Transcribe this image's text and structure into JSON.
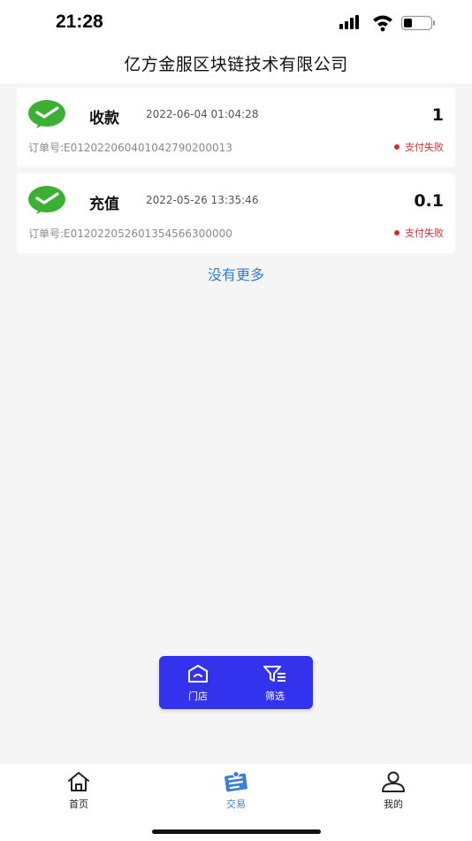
{
  "status_bar": {
    "time": "21:28"
  },
  "header": {
    "title": "亿方金服区块链技术有限公司"
  },
  "transactions": [
    {
      "type": "收款",
      "datetime": "2022-06-04 01:04:28",
      "amount": "1",
      "order_no": "订单号:E012022060401042790200013",
      "status": "支付失败"
    },
    {
      "type": "充值",
      "datetime": "2022-05-26 13:35:46",
      "amount": "0.1",
      "order_no": "订单号:E012022052601354566300000",
      "status": "支付失败"
    }
  ],
  "list_footer": "没有更多",
  "float_toolbar": {
    "store_label": "门店",
    "filter_label": "筛选"
  },
  "tabbar": {
    "home_label": "首页",
    "trade_label": "交易",
    "mine_label": "我的"
  },
  "colors": {
    "accent_blue": "#3333ee",
    "link_blue": "#2f7fd0",
    "active_tab": "#3f7ed6",
    "fail_red": "#d02f2f",
    "wechat_green": "#3cb035"
  }
}
